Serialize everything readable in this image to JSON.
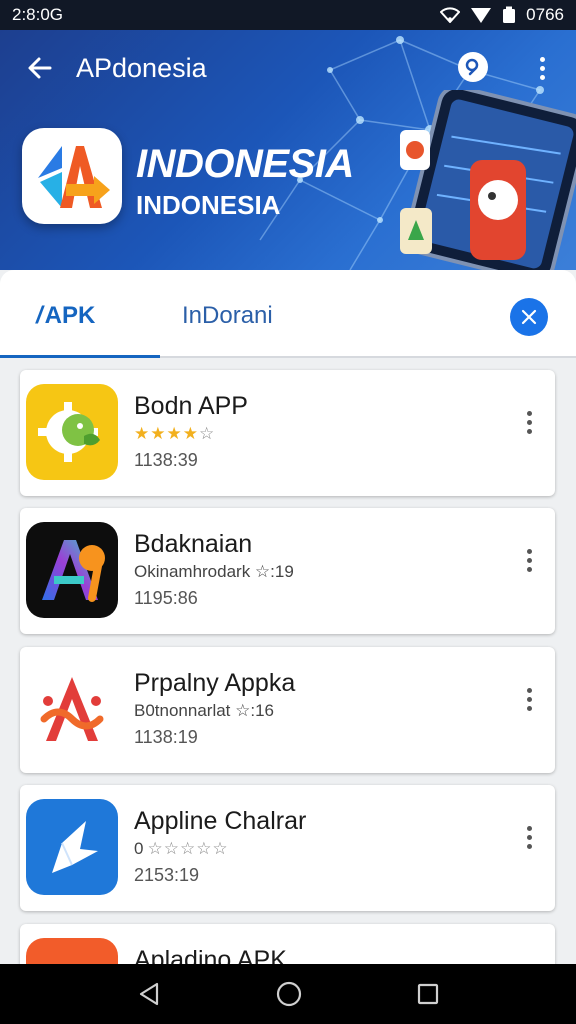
{
  "status": {
    "time": "2:8:0G",
    "battery_text": "0766"
  },
  "header": {
    "title": "APdonesia",
    "banner_title": "INDONESIA",
    "banner_subtitle": "INDONESIA"
  },
  "tabs": [
    {
      "slash": "/",
      "label": "APK",
      "active": true
    },
    {
      "label": "InDorani",
      "active": false
    }
  ],
  "colors": {
    "accent": "#1565c0",
    "header": "#1c56b8",
    "close_button": "#1a73e8",
    "star": "#f2b01e"
  },
  "apps": [
    {
      "name": "Bodn APP",
      "subtitle": "",
      "rating": 4,
      "meta": "1138:39",
      "icon": "green-gear-icon"
    },
    {
      "name": "Bdaknaian",
      "subtitle": "Okinamhrodark ☆:19",
      "rating": null,
      "meta": "1195:86",
      "icon": "letter-a-icon"
    },
    {
      "name": "Prpalny Appka",
      "subtitle": "B0tnonnarlat ☆:16",
      "rating": null,
      "meta": "1138:19",
      "icon": "red-swirl-icon"
    },
    {
      "name": "Appline Chalrar",
      "subtitle": "0",
      "rating": 0,
      "meta": "2153:19",
      "icon": "paper-bird-icon"
    },
    {
      "name": "Apladino APK",
      "subtitle": "",
      "rating": null,
      "meta": "",
      "icon": "orange-app-icon"
    }
  ]
}
